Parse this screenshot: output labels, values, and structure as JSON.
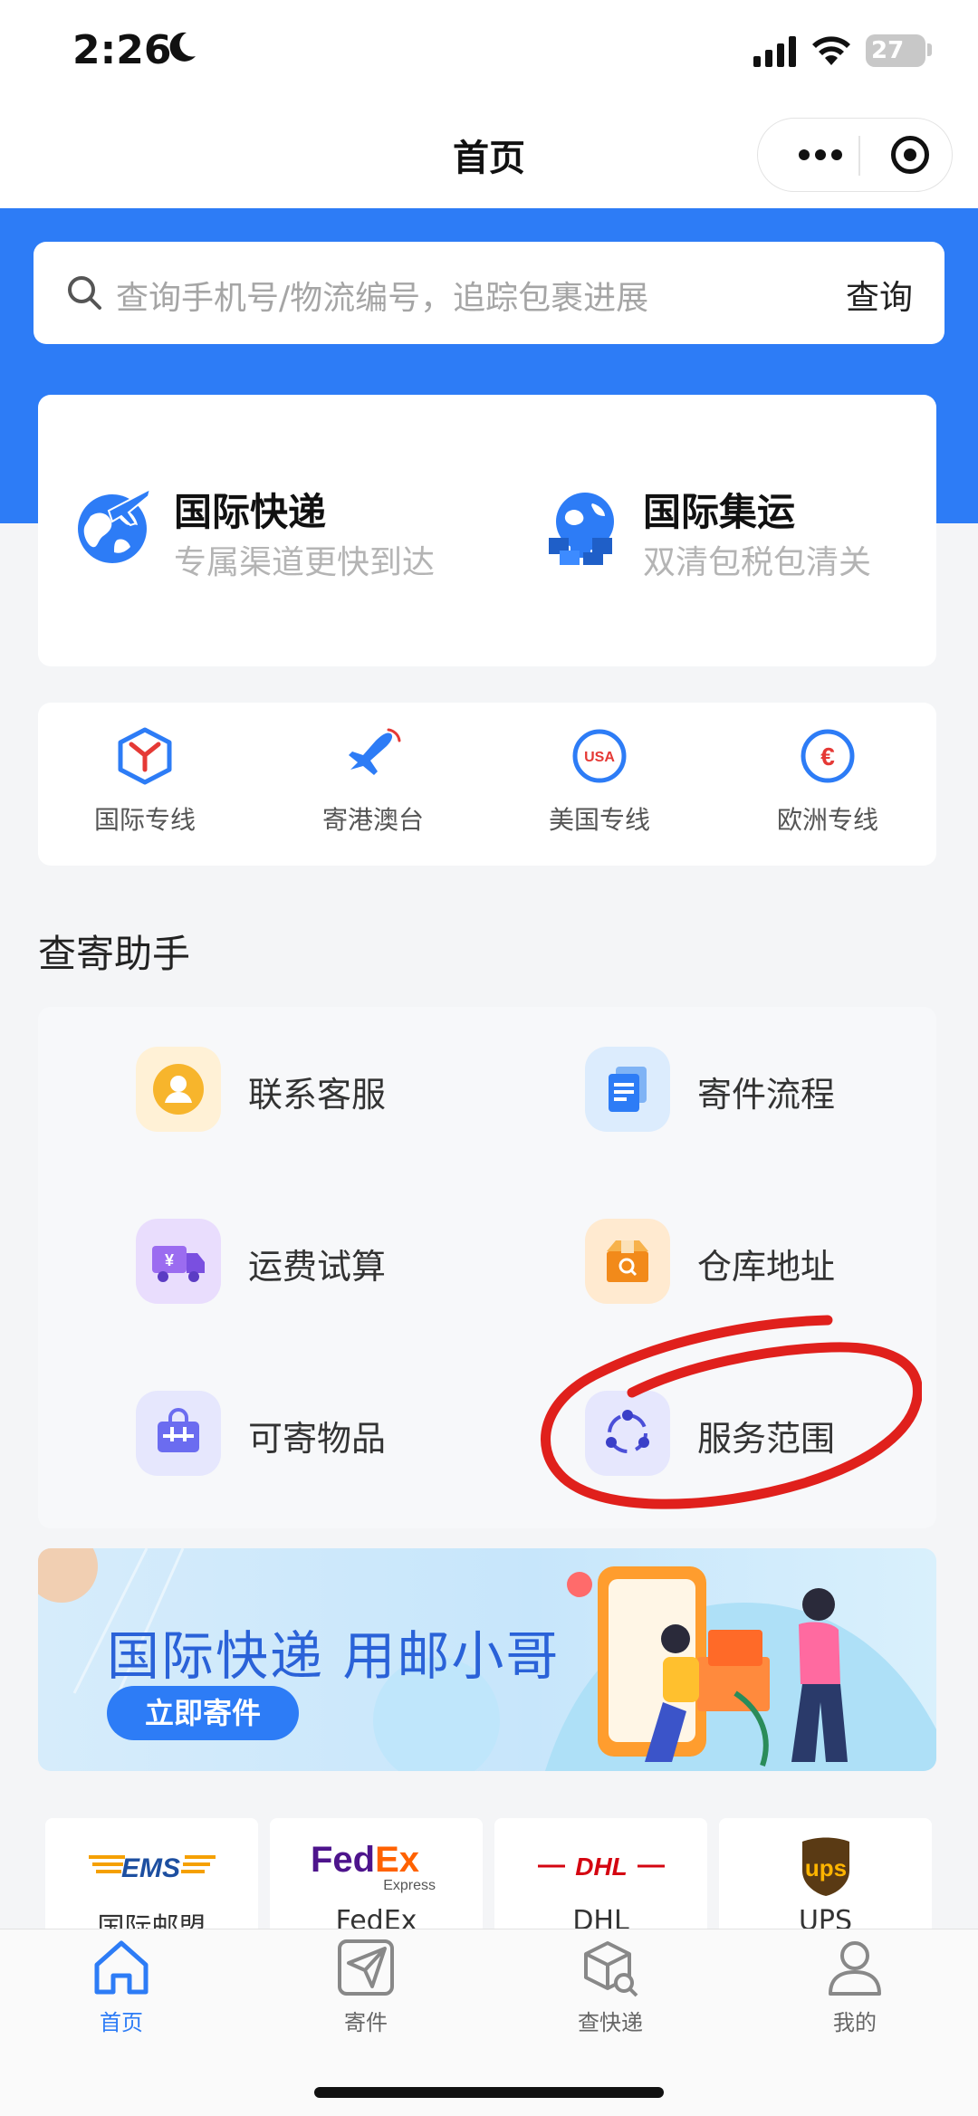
{
  "status_bar": {
    "time": "2:26",
    "battery": "27"
  },
  "nav": {
    "title": "首页"
  },
  "search": {
    "placeholder": "查询手机号/物流编号，追踪包裹进展",
    "button": "查询"
  },
  "features": [
    {
      "title": "国际快递",
      "subtitle": "专属渠道更快到达",
      "icon": "globe-plane-icon"
    },
    {
      "title": "国际集运",
      "subtitle": "双清包税包清关",
      "icon": "globe-boxes-icon"
    }
  ],
  "quick_lines": [
    {
      "label": "国际专线",
      "icon": "box-icon"
    },
    {
      "label": "寄港澳台",
      "icon": "plane-icon"
    },
    {
      "label": "美国专线",
      "icon": "usa-badge-icon"
    },
    {
      "label": "欧洲专线",
      "icon": "euro-icon"
    }
  ],
  "helper": {
    "title": "查寄助手",
    "items": [
      {
        "label": "联系客服",
        "icon": "service-icon"
      },
      {
        "label": "寄件流程",
        "icon": "document-icon"
      },
      {
        "label": "运费试算",
        "icon": "truck-icon"
      },
      {
        "label": "仓库地址",
        "icon": "warehouse-icon"
      },
      {
        "label": "可寄物品",
        "icon": "bag-icon"
      },
      {
        "label": "服务范围",
        "icon": "network-icon"
      }
    ]
  },
  "banner": {
    "title": "国际快递 用邮小哥",
    "button": "立即寄件"
  },
  "carriers": [
    {
      "logo": "EMS",
      "name": "国际邮盟"
    },
    {
      "logo": "FedEx",
      "sub": "Express",
      "name": "FedEx"
    },
    {
      "logo": "DHL",
      "name": "DHL"
    },
    {
      "logo": "ups",
      "name": "UPS"
    }
  ],
  "tabs": [
    {
      "label": "首页",
      "icon": "home-icon",
      "active": true
    },
    {
      "label": "寄件",
      "icon": "send-icon"
    },
    {
      "label": "查快递",
      "icon": "track-icon"
    },
    {
      "label": "我的",
      "icon": "profile-icon"
    }
  ],
  "colors": {
    "brand_blue": "#2d7cf6",
    "annotation_red": "#e0201c"
  }
}
